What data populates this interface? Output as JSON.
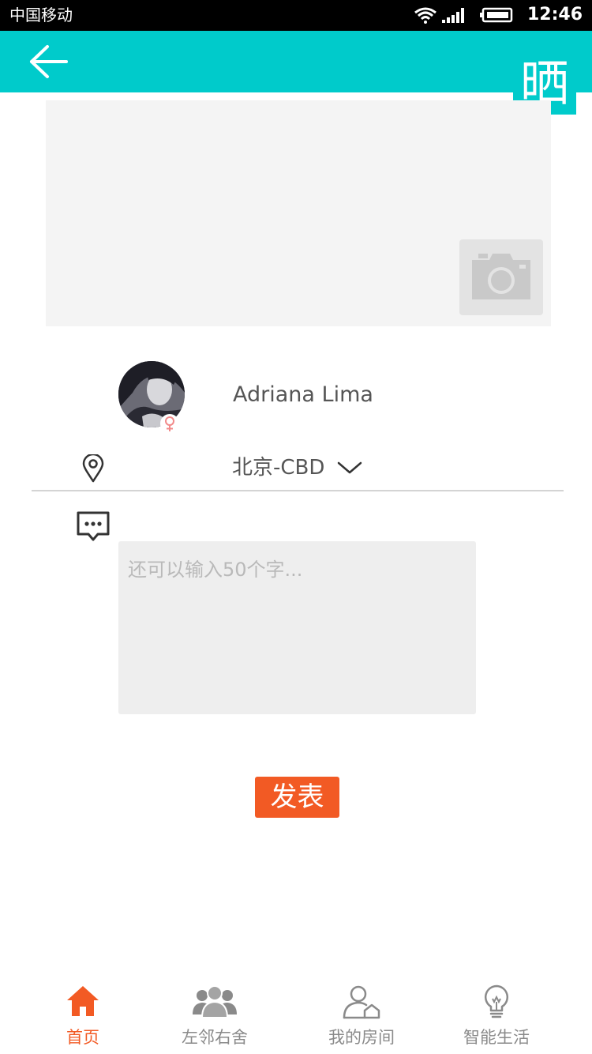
{
  "status_bar": {
    "carrier": "中国移动",
    "time": "12:46"
  },
  "nav": {
    "badge": "晒"
  },
  "profile": {
    "name": "Adriana Lima"
  },
  "location": {
    "value": "北京-CBD"
  },
  "comment": {
    "placeholder": "还可以输入50个字..."
  },
  "submit": {
    "label": "发表"
  },
  "tabs": [
    {
      "label": "首页",
      "icon": "home-icon",
      "active": true
    },
    {
      "label": "左邻右舍",
      "icon": "neighbors-icon",
      "active": false
    },
    {
      "label": "我的房间",
      "icon": "my-room-icon",
      "active": false
    },
    {
      "label": "智能生活",
      "icon": "lightbulb-icon",
      "active": false
    }
  ],
  "colors": {
    "accent": "#00cbcb",
    "primary": "#f25a24",
    "tab_inactive": "#8a8a8a"
  }
}
